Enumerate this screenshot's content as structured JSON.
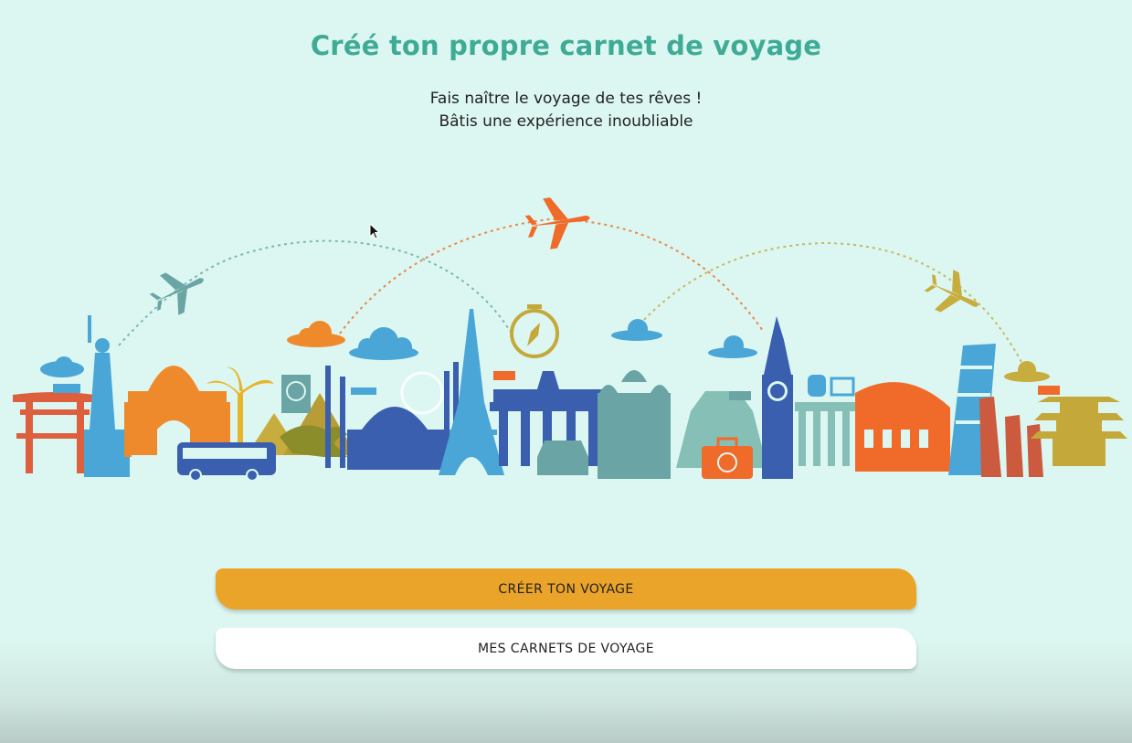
{
  "header": {
    "title": "Créé ton propre carnet de voyage",
    "subtitle_line1": "Fais naître le voyage de tes rêves !",
    "subtitle_line2": "Bâtis une expérience inoubliable"
  },
  "buttons": {
    "create_label": "CRÉER TON VOYAGE",
    "notebooks_label": "MES CARNETS DE VOYAGE"
  },
  "colors": {
    "background": "#dcf7f1",
    "title": "#3fab96",
    "primary_button": "#eba42a",
    "secondary_button": "#ffffff"
  },
  "illustration": {
    "name": "world-landmarks-skyline",
    "icons": [
      "torii-gate-icon",
      "statue-of-liberty-icon",
      "taj-mahal-icon",
      "palm-tree-icon",
      "bus-icon",
      "pyramids-icon",
      "kangaroo-icon",
      "mosque-icon",
      "eiffel-tower-icon",
      "brandenburg-gate-icon",
      "car-icon",
      "cathedral-icon",
      "mayan-pyramid-icon",
      "big-ben-icon",
      "suitcase-icon",
      "colosseum-icon",
      "pisa-tower-icon",
      "moai-icon",
      "pagoda-icon",
      "compass-icon",
      "airplane-icon",
      "cloud-icon"
    ]
  }
}
